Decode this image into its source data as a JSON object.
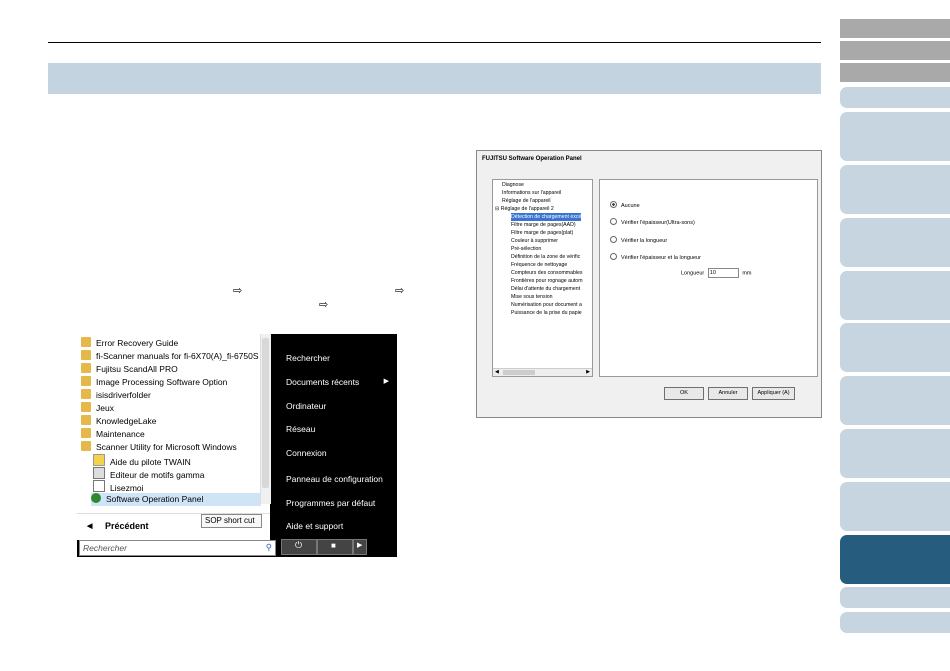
{
  "page": {
    "arrow": "⇨"
  },
  "start_menu": {
    "partial_top_left": "",
    "partial_top_right": "...",
    "programs": [
      {
        "label": "Error Recovery Guide",
        "kind": "folder"
      },
      {
        "label": "fi-Scanner manuals for fi-6X70(A)_fi-6750S",
        "kind": "folder"
      },
      {
        "label": "Fujitsu ScandAll PRO",
        "kind": "folder"
      },
      {
        "label": "Image Processing Software Option",
        "kind": "folder"
      },
      {
        "label": "isisdriverfolder",
        "kind": "folder"
      },
      {
        "label": "Jeux",
        "kind": "folder"
      },
      {
        "label": "KnowledgeLake",
        "kind": "folder"
      },
      {
        "label": "Maintenance",
        "kind": "folder"
      },
      {
        "label": "Scanner Utility for Microsoft Windows",
        "kind": "folder"
      },
      {
        "label": "Aide du pilote TWAIN",
        "kind": "help"
      },
      {
        "label": "Editeur de motifs gamma",
        "kind": "tool"
      },
      {
        "label": "Lisezmoi",
        "kind": "doc"
      },
      {
        "label": "Software Operation Panel",
        "kind": "app"
      }
    ],
    "tooltip": "SOP short cut",
    "previous": "Précédent",
    "search_placeholder": "Rechercher",
    "right_items": [
      "Rechercher",
      "Documents récents",
      "Ordinateur",
      "Réseau",
      "Connexion",
      "Panneau de configuration",
      "Programmes par défaut",
      "Aide et support"
    ]
  },
  "dialog": {
    "title": "FUJITSU Software Operation Panel",
    "tree": [
      {
        "label": "Diagnose",
        "level": 1
      },
      {
        "label": "Informations sur l'appareil",
        "level": 1
      },
      {
        "label": "Réglage de l'appareil",
        "level": 1
      },
      {
        "label": "Réglage de l'appareil 2",
        "level": 0
      },
      {
        "label": "Détection de chargement excé",
        "level": 2,
        "selected": true
      },
      {
        "label": "Filtre marge de pages(AAD)",
        "level": 2
      },
      {
        "label": "Filtre marge de pages(plat)",
        "level": 2
      },
      {
        "label": "Couleur à supprimer",
        "level": 2
      },
      {
        "label": "Pré-sélection",
        "level": 2
      },
      {
        "label": "Définition de la zone de vérific",
        "level": 2
      },
      {
        "label": "Fréquence de nettoyage",
        "level": 2
      },
      {
        "label": "Compteurs des consommables",
        "level": 2
      },
      {
        "label": "Frontières pour rognage autom",
        "level": 2
      },
      {
        "label": "Délai d'attente du chargement",
        "level": 2
      },
      {
        "label": "Mise sous tension",
        "level": 2
      },
      {
        "label": "Numérisation pour document a",
        "level": 2
      },
      {
        "label": "Puissance de la prise du papie",
        "level": 2
      }
    ],
    "options": [
      {
        "label": "Aucune",
        "selected": true
      },
      {
        "label": "Vérifier l'épaisseur(Ultra-sons)",
        "selected": false
      },
      {
        "label": "Vérifier la longueur",
        "selected": false
      },
      {
        "label": "Vérifier l'épaisseur et la longueur",
        "selected": false
      }
    ],
    "length_label": "Longueur",
    "length_value": "10",
    "length_unit": "mm",
    "buttons": {
      "ok": "OK",
      "cancel": "Annuler",
      "apply": "Appliquer (A)"
    }
  },
  "side_tabs": [
    {
      "style": "gray"
    },
    {
      "style": "gray"
    },
    {
      "style": "gray"
    },
    {
      "style": "light"
    },
    {
      "style": "light"
    },
    {
      "style": "light"
    },
    {
      "style": "light"
    },
    {
      "style": "light"
    },
    {
      "style": "light"
    },
    {
      "style": "light"
    },
    {
      "style": "light"
    },
    {
      "style": "light"
    },
    {
      "style": "active"
    },
    {
      "style": "light"
    },
    {
      "style": "light"
    }
  ]
}
